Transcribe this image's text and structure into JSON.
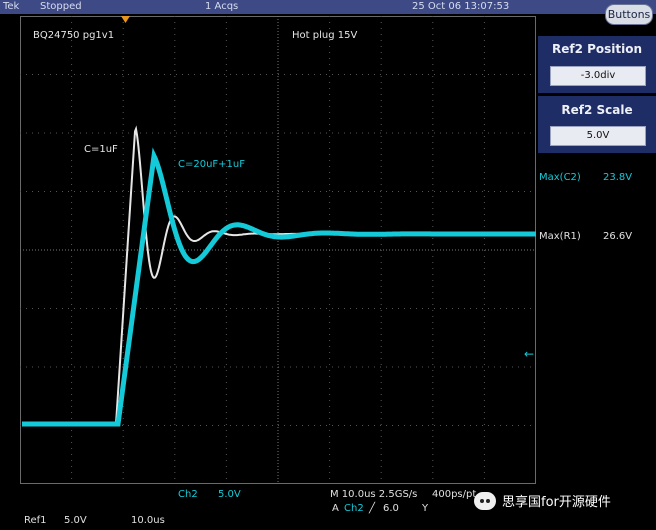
{
  "topbar": {
    "brand": "Tek",
    "state": "Stopped",
    "acqs": "1 Acqs",
    "datetime": "25 Oct 06 13:07:53"
  },
  "buttons_label": "Buttons",
  "plot": {
    "label_left": "BQ24750 pg1v1",
    "label_right": "Hot plug 15V",
    "trace_white_label": "C=1uF",
    "trace_cyan_label": "C=20uF+1uF",
    "ref_marker": "R1"
  },
  "panel_position": {
    "title": "Ref2 Position",
    "value": "-3.0div"
  },
  "panel_scale": {
    "title": "Ref2 Scale",
    "value": "5.0V"
  },
  "measurements": [
    {
      "name": "Max(C2)",
      "value": "23.8V"
    },
    {
      "name": "Max(R1)",
      "value": "26.6V"
    }
  ],
  "bottom": {
    "ch2": "Ch2",
    "ch2_scale": "5.0V",
    "timebase": "M 10.0us 2.5GS/s",
    "record": "400ps/pt",
    "trigger_src": "A",
    "trigger_ch": "Ch2",
    "trigger_slope": "╱",
    "trigger_level": "6.0",
    "trigger_y": "Y",
    "ref1": "Ref1",
    "ref1_scale": "5.0V",
    "ref1_time": "10.0us"
  },
  "watermark": "思享国for开源硬件",
  "colors": {
    "cyan": "#14cad8",
    "white": "#e6e6e6",
    "topbar": "#3d4a86",
    "panel": "#1f2d66"
  }
}
